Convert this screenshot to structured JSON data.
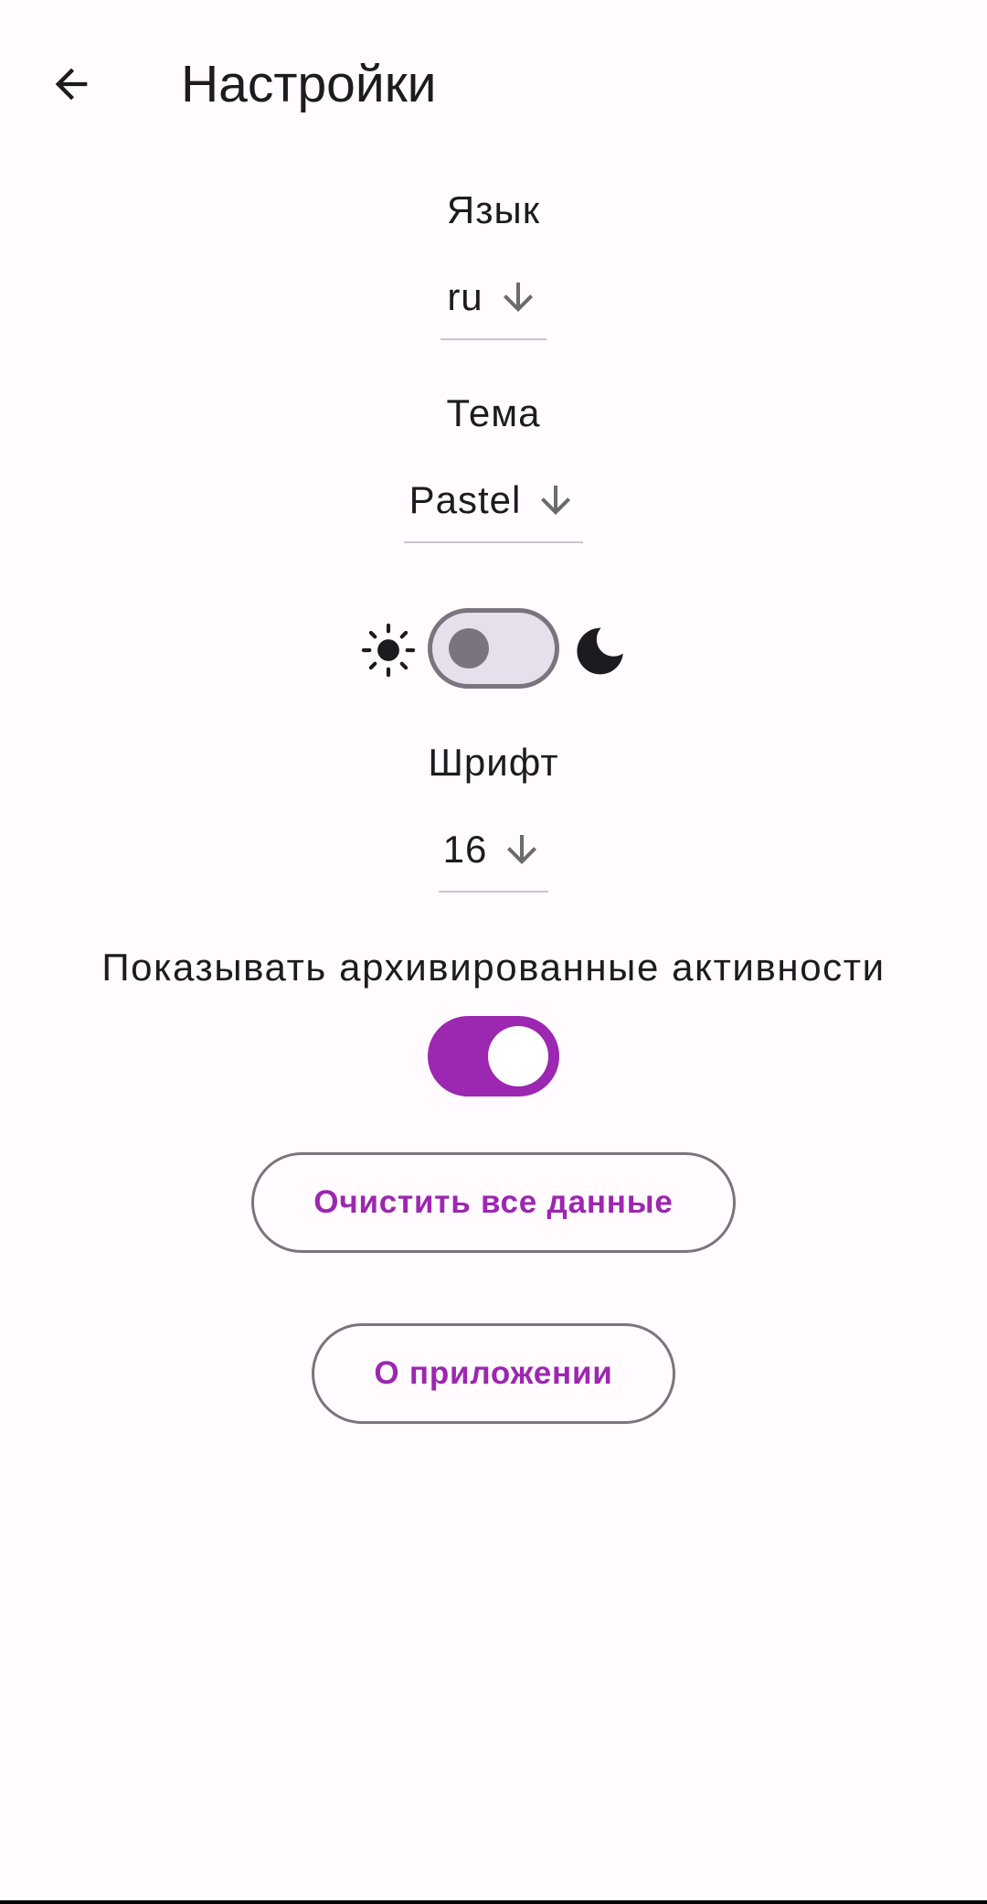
{
  "header": {
    "title": "Настройки",
    "back_icon": "arrow-back-icon"
  },
  "language": {
    "label": "Язык",
    "value": "ru",
    "arrow_icon": "arrow-down-icon"
  },
  "theme": {
    "label": "Тема",
    "value": "Pastel",
    "arrow_icon": "arrow-down-icon",
    "dark_mode_enabled": false,
    "light_icon": "sun-icon",
    "dark_icon": "moon-icon"
  },
  "font": {
    "label": "Шрифт",
    "value": "16",
    "arrow_icon": "arrow-down-icon"
  },
  "archive": {
    "label": "Показывать архивированные активности",
    "enabled": true
  },
  "buttons": {
    "clear_data": "Очистить все данные",
    "about": "О приложении"
  },
  "colors": {
    "background": "#fffbfe",
    "accent": "#9c27b0",
    "outline": "#79747e",
    "text": "#1d1b20"
  }
}
